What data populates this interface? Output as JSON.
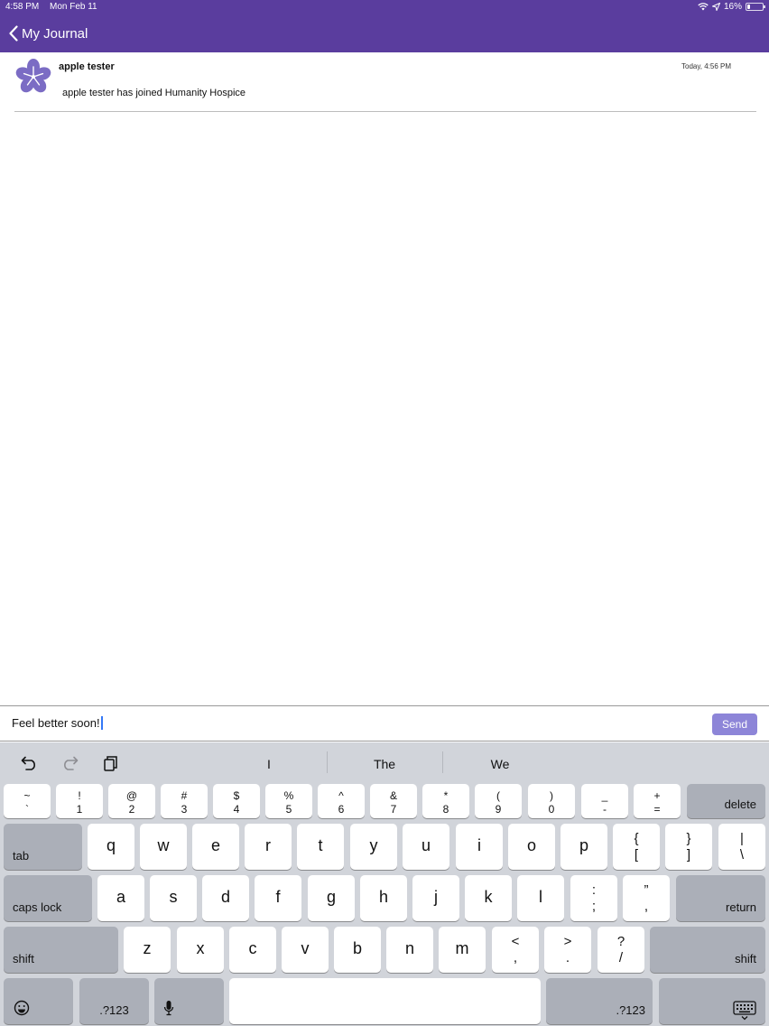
{
  "status": {
    "time": "4:58 PM",
    "date": "Mon Feb 11",
    "battery": "16%",
    "battery_level": 0.16
  },
  "nav": {
    "back_label": "My Journal"
  },
  "entry": {
    "author": "apple tester",
    "timestamp": "Today, 4:56 PM",
    "message": "apple tester has joined Humanity Hospice"
  },
  "composer": {
    "value": "Feel better soon!",
    "send_label": "Send"
  },
  "keyboard": {
    "suggestions": [
      "I",
      "The",
      "We"
    ],
    "row1": [
      {
        "top": "~",
        "bottom": "`"
      },
      {
        "top": "!",
        "bottom": "1"
      },
      {
        "top": "@",
        "bottom": "2"
      },
      {
        "top": "#",
        "bottom": "3"
      },
      {
        "top": "$",
        "bottom": "4"
      },
      {
        "top": "%",
        "bottom": "5"
      },
      {
        "top": "^",
        "bottom": "6"
      },
      {
        "top": "&",
        "bottom": "7"
      },
      {
        "top": "*",
        "bottom": "8"
      },
      {
        "top": "(",
        "bottom": "9"
      },
      {
        "top": ")",
        "bottom": "0"
      },
      {
        "top": "_",
        "bottom": "-"
      },
      {
        "top": "+",
        "bottom": "="
      }
    ],
    "delete_label": "delete",
    "tab_label": "tab",
    "row2": [
      "q",
      "w",
      "e",
      "r",
      "t",
      "y",
      "u",
      "i",
      "o",
      "p"
    ],
    "row2_sym": [
      {
        "top": "{",
        "bottom": "["
      },
      {
        "top": "}",
        "bottom": "]"
      },
      {
        "top": "|",
        "bottom": "\\"
      }
    ],
    "caps_label": "caps lock",
    "row3": [
      "a",
      "s",
      "d",
      "f",
      "g",
      "h",
      "j",
      "k",
      "l"
    ],
    "row3_sym": [
      {
        "top": ":",
        "bottom": ";"
      },
      {
        "top": "”",
        "bottom": ","
      }
    ],
    "return_label": "return",
    "shift_label": "shift",
    "row4": [
      "z",
      "x",
      "c",
      "v",
      "b",
      "n",
      "m"
    ],
    "row4_sym": [
      {
        "top": "<",
        "bottom": ","
      },
      {
        "top": ">",
        "bottom": "."
      },
      {
        "top": "?",
        "bottom": "/"
      }
    ],
    "numbers_label": ".?123"
  }
}
